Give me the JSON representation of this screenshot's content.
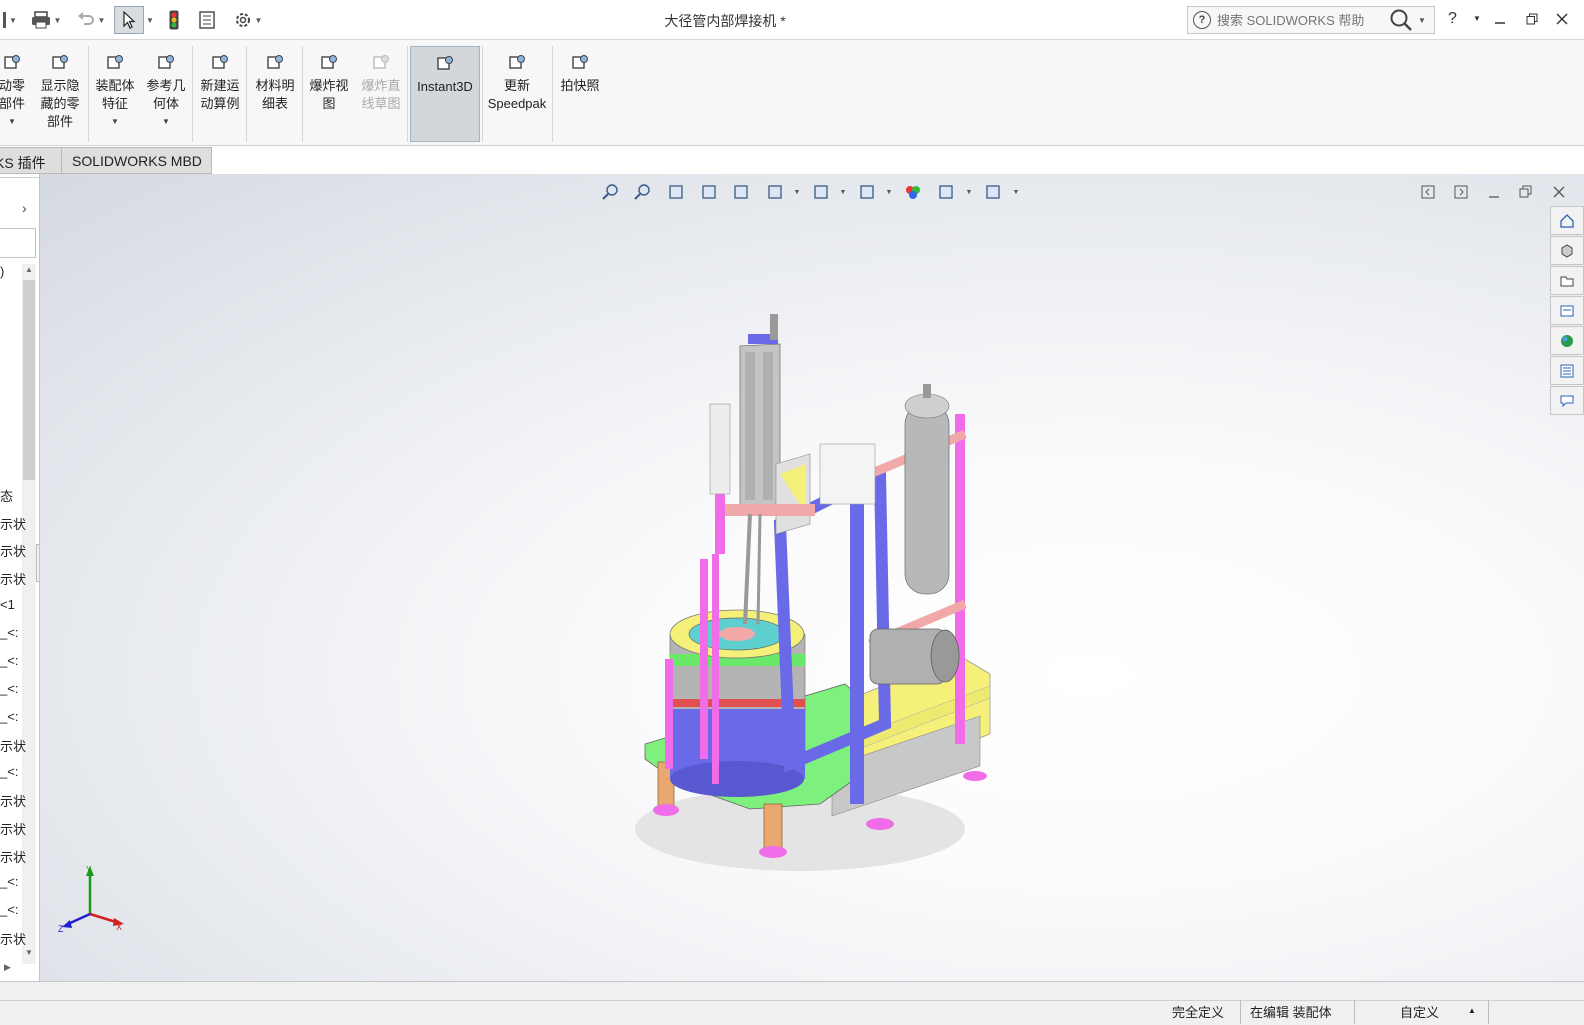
{
  "app": {
    "document_title": "大径管内部焊接机 *"
  },
  "search": {
    "placeholder": "搜索 SOLIDWORKS 帮助"
  },
  "help": {
    "label": "?"
  },
  "ribbon": {
    "items": [
      {
        "label": "动零\n部件",
        "icon": "move-component-icon",
        "disabled": false
      },
      {
        "label": "显示隐\n藏的零\n部件",
        "icon": "show-hidden-components-icon",
        "disabled": false
      },
      {
        "label": "装配体\n特征",
        "icon": "assembly-features-icon",
        "disabled": false
      },
      {
        "label": "参考几\n何体",
        "icon": "reference-geometry-icon",
        "disabled": false
      },
      {
        "label": "新建运\n动算例",
        "icon": "new-motion-study-icon",
        "disabled": false
      },
      {
        "label": "材料明\n细表",
        "icon": "bill-of-materials-icon",
        "disabled": false
      },
      {
        "label": "爆炸视\n图",
        "icon": "exploded-view-icon",
        "disabled": false
      },
      {
        "label": "爆炸直\n线草图",
        "icon": "explode-line-sketch-icon",
        "disabled": true
      },
      {
        "label": "Instant3D",
        "icon": "instant3d-icon",
        "disabled": false,
        "active": true
      },
      {
        "label": "更新\nSpeedpak",
        "icon": "update-speedpak-icon",
        "disabled": false
      },
      {
        "label": "拍快照",
        "icon": "take-snapshot-icon",
        "disabled": false
      }
    ]
  },
  "tabs": [
    "KS 插件",
    "SOLIDWORKS MBD"
  ],
  "tree": {
    "items": [
      ")",
      "态",
      "示状",
      "示状",
      "示状",
      "<1",
      "_<:",
      "_<:",
      "_<:",
      "_<:",
      "示状",
      "_<:",
      "示状",
      "示状",
      "示状",
      "_<:",
      "_<:",
      "示状"
    ]
  },
  "triad": {
    "x": "X",
    "y": "Y",
    "z": "Z"
  },
  "status": {
    "definition": "完全定义",
    "editing": "在编辑 装配体",
    "custom": "自定义"
  },
  "colors": {
    "ribbon_bg": "#f7f7f7",
    "active_button": "#d3d6da",
    "viewport_center": "#ffffff",
    "viewport_edge": "#d5d9e0",
    "frame_blue": "#6a6ae8",
    "frame_pink": "#f06ce8",
    "base_yellow": "#f5f07a",
    "base_green": "#7df07d"
  }
}
